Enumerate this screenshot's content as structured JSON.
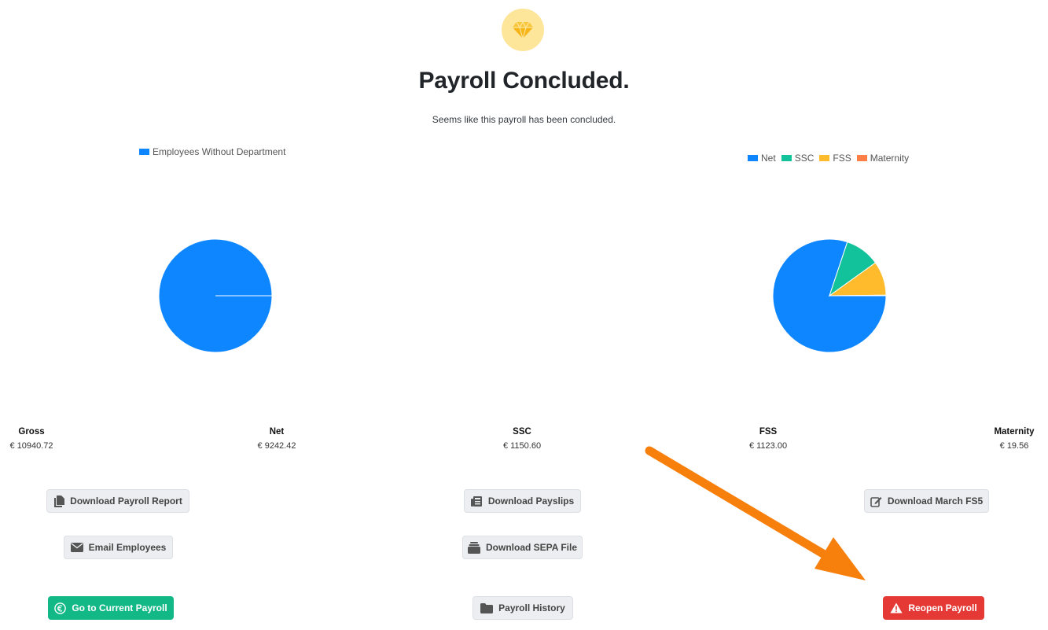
{
  "header": {
    "badge_icon": "diamond-icon",
    "title": "Payroll Concluded.",
    "subtitle": "Seems like this payroll has been concluded."
  },
  "charts": {
    "left_legend": [
      "Employees Without Department"
    ],
    "right_legend": [
      "Net",
      "SSC",
      "FSS",
      "Maternity"
    ]
  },
  "stats": [
    {
      "label": "Gross",
      "value": "€ 10940.72"
    },
    {
      "label": "Net",
      "value": "€ 9242.42"
    },
    {
      "label": "SSC",
      "value": "€ 1150.60"
    },
    {
      "label": "FSS",
      "value": "€ 1123.00"
    },
    {
      "label": "Maternity",
      "value": "€ 19.56"
    }
  ],
  "buttons": {
    "download_payroll_report": "Download Payroll Report",
    "download_payslips": "Download Payslips",
    "download_march_fs5": "Download March FS5",
    "email_employees": "Email Employees",
    "download_sepa_file": "Download SEPA File",
    "go_to_current_payroll": "Go to Current Payroll",
    "payroll_history": "Payroll History",
    "reopen_payroll": "Reopen Payroll"
  },
  "colors": {
    "net": "#0d86ff",
    "ssc": "#12c29b",
    "fss": "#ffbb2b",
    "maternity": "#fd7f45",
    "green": "#12b886",
    "red": "#e53935",
    "annotation_arrow": "#f77f0c"
  },
  "chart_data": [
    {
      "type": "pie",
      "labels": [
        "Employees Without Department"
      ],
      "values": [
        9242.42
      ],
      "colors": [
        "#0d86ff"
      ],
      "legend": "top"
    },
    {
      "type": "pie",
      "labels": [
        "Net",
        "SSC",
        "FSS",
        "Maternity"
      ],
      "values": [
        9242.42,
        1150.6,
        1123.0,
        19.56
      ],
      "colors": [
        "#0d86ff",
        "#12c29b",
        "#ffbb2b",
        "#fd7f45"
      ],
      "legend": "top"
    }
  ]
}
